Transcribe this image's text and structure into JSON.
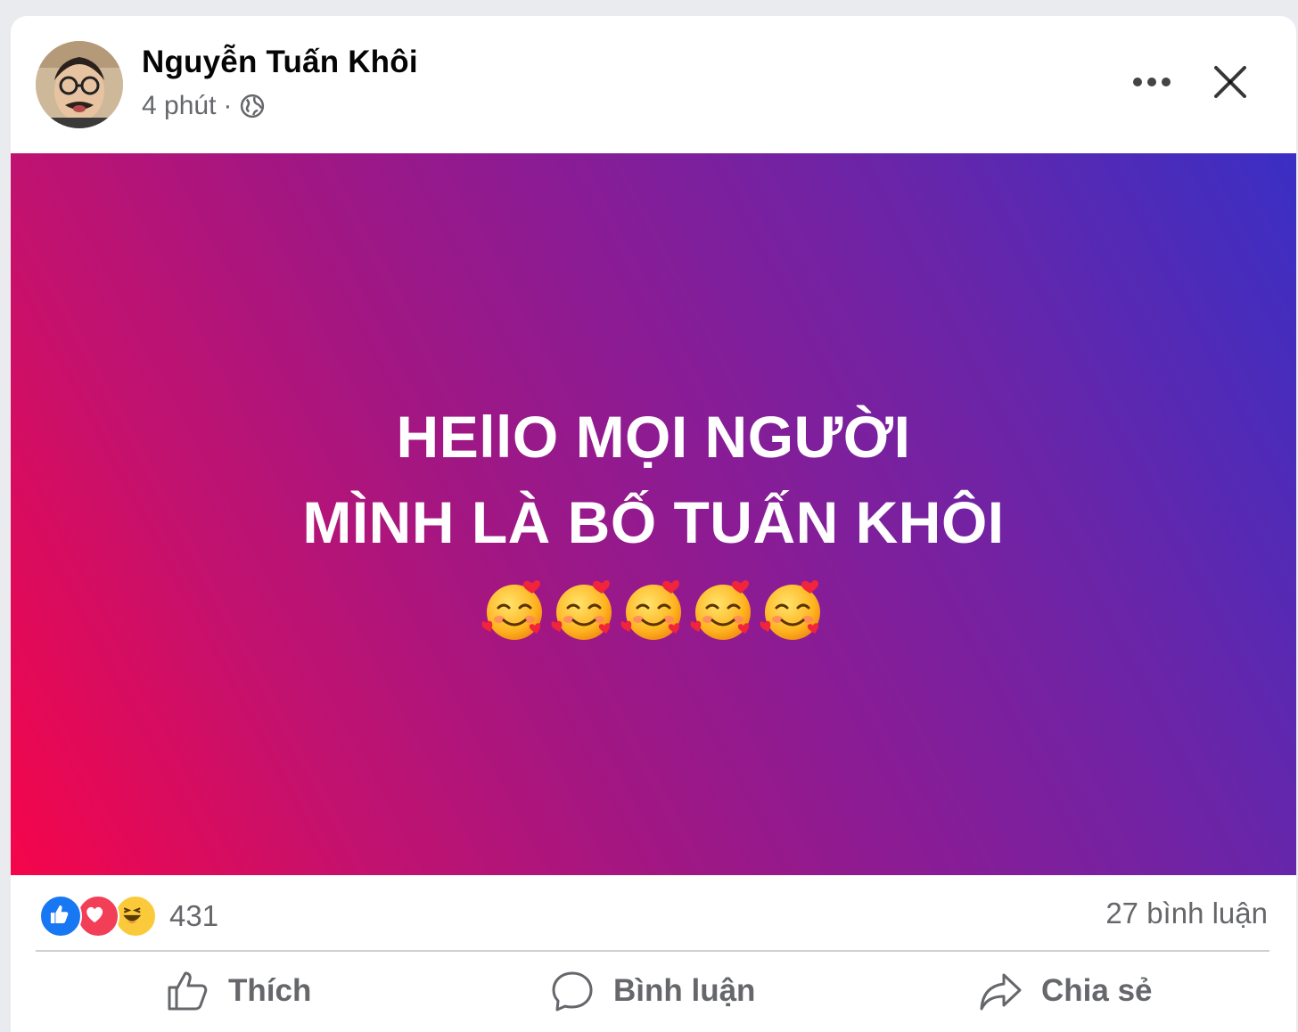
{
  "post": {
    "author": "Nguyễn Tuấn Khôi",
    "time": "4 phút",
    "separator": "·",
    "privacy_icon": "globe-icon",
    "text_line1": "HEllO MỌI NGƯỜI",
    "text_line2": "MÌNH LÀ BỐ TUẤN KHÔI",
    "emoji_icon": "smiling-face-with-hearts-icon",
    "emoji_count": 5,
    "background_colors": [
      "#f5054a",
      "#a01784",
      "#3a2fc4"
    ]
  },
  "header": {
    "more_icon": "more-dots-icon",
    "close_icon": "close-icon"
  },
  "stats": {
    "reaction_icons": [
      "like-icon",
      "love-icon",
      "haha-icon"
    ],
    "reaction_count": "431",
    "comment_count": "27 bình luận"
  },
  "actions": {
    "like_label": "Thích",
    "comment_label": "Bình luận",
    "share_label": "Chia sẻ"
  },
  "colors": {
    "like_blue": "#1877f2",
    "love_red": "#f33e58",
    "haha_yellow": "#fbca3b",
    "muted_text": "#65676b"
  }
}
